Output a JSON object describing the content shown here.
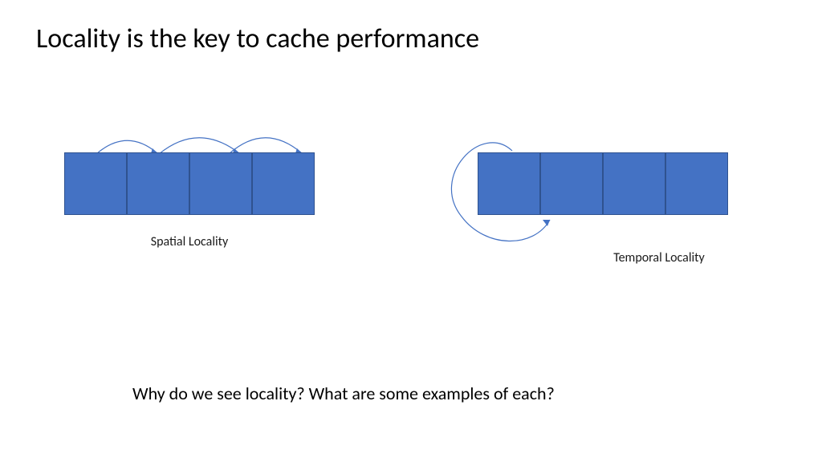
{
  "title": "Locality is the key to cache performance",
  "diagrams": {
    "spatial": {
      "label": "Spatial Locality",
      "block_count": 4
    },
    "temporal": {
      "label": "Temporal Locality",
      "block_count": 4
    }
  },
  "question": "Why do we see locality?  What are some examples of each?",
  "colors": {
    "block_fill": "#4472c4",
    "block_border": "#2f528f",
    "arrow": "#4472c4"
  }
}
